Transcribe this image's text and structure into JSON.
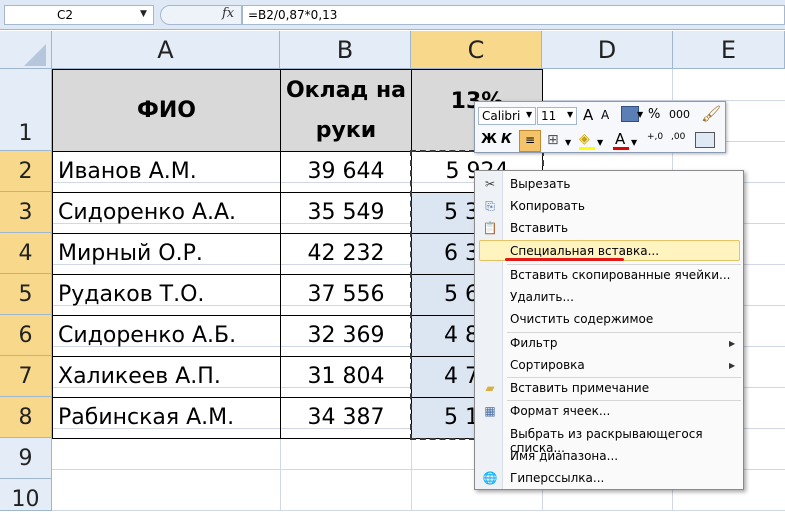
{
  "formula_bar": {
    "name_box": "C2",
    "fx_label": "fx",
    "formula": "=B2/0,87*0,13"
  },
  "columns": [
    "A",
    "B",
    "C",
    "D",
    "E"
  ],
  "rows": [
    "1",
    "2",
    "3",
    "4",
    "5",
    "6",
    "7",
    "8",
    "9",
    "10"
  ],
  "header_row": {
    "a": "ФИО",
    "b1": "Оклад на",
    "b2": "руки",
    "c": "13%"
  },
  "data_rows": [
    {
      "name": "Иванов А.М.",
      "salary": "39 644",
      "tax": "5 924"
    },
    {
      "name": "Сидоренко А.А.",
      "salary": "35 549",
      "tax": "5 3"
    },
    {
      "name": "Мирный О.Р.",
      "salary": "42 232",
      "tax": "6 3"
    },
    {
      "name": "Рудаков Т.О.",
      "salary": "37 556",
      "tax": "5 6"
    },
    {
      "name": "Сидоренко А.Б.",
      "salary": "32 369",
      "tax": "4 8"
    },
    {
      "name": "Халикеев А.П.",
      "salary": "31 804",
      "tax": "4 7"
    },
    {
      "name": "Рабинская А.М.",
      "salary": "34 387",
      "tax": "5 1"
    }
  ],
  "mini_toolbar": {
    "font_name": "Calibri",
    "font_size": "11",
    "grow": "A",
    "shrink": "A",
    "percent": "%",
    "thousands": "000",
    "bold": "Ж",
    "italic": "К",
    "font_color_letter": "A",
    "inc_decimal": "+,0",
    "dec_decimal": ",00"
  },
  "context_menu": {
    "items": [
      "Вырезать",
      "Копировать",
      "Вставить",
      "Специальная вставка...",
      "Вставить скопированные ячейки...",
      "Удалить...",
      "Очистить содержимое",
      "Фильтр",
      "Сортировка",
      "Вставить примечание",
      "Формат ячеек...",
      "Выбрать из раскрывающегося списка...",
      "Имя диапазона...",
      "Гиперссылка..."
    ],
    "highlighted_item": "Специальная вставка...",
    "highlight_color": "#fff3c0",
    "annotation_color": "#e01818"
  },
  "colors": {
    "selected_header": "#f8d98b",
    "header_bg": "#e4ecf7",
    "title_row_bg": "#d9d9d9"
  }
}
